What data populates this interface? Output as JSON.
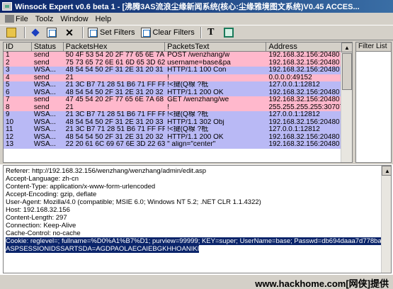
{
  "window": {
    "title": "Winsock Expert v0.6 beta 1 - [沸腾3AS流浪尘缘新闻系统(核心:尘缘雅境图文系统)V0.45 ACCES..."
  },
  "menu": {
    "items": [
      "File",
      "Toolz",
      "Window",
      "Help"
    ]
  },
  "toolbar": {
    "set_filters": "Set Filters",
    "clear_filters": "Clear Filters"
  },
  "grid": {
    "columns": [
      "ID",
      "Status",
      "PacketsHex",
      "PacketsText",
      "Address"
    ],
    "rows": [
      {
        "id": "1",
        "status": "send",
        "hex": "50 4F 53 54 20 2F 77 65 6E 7A 6...",
        "text": "POST /wenzhang/w",
        "address": "192.168.32.156:20480",
        "kind": "send"
      },
      {
        "id": "2",
        "status": "send",
        "hex": "75 73 65 72 6E 61 6D 65 3D 62 6...",
        "text": "username=base&pa",
        "address": "192.168.32.156:20480",
        "kind": "send"
      },
      {
        "id": "3",
        "status": "WSA...",
        "hex": "48 54 54 50 2F 31 2E 31 20 31 3...",
        "text": "HTTP/1.1 100 Con",
        "address": "192.168.32.156:20480",
        "kind": "recv"
      },
      {
        "id": "4",
        "status": "send",
        "hex": "21",
        "text": "!",
        "address": "0.0.0.0:49152",
        "kind": "send"
      },
      {
        "id": "5",
        "status": "WSA...",
        "hex": "21 3C B7 71 28 51 B6 71 FF FF F...",
        "text": "!<揵(Q楾          ?柢",
        "address": "127.0.0.1:12812",
        "kind": "recv"
      },
      {
        "id": "6",
        "status": "WSA...",
        "hex": "48 54 54 50 2F 31 2E 31 20 32 3...",
        "text": "HTTP/1.1 200 OK",
        "address": "192.168.32.156:20480",
        "kind": "recv"
      },
      {
        "id": "7",
        "status": "send",
        "hex": "47 45 54 20 2F 77 65 6E 7A 68 6...",
        "text": "GET /wenzhang/we",
        "address": "192.168.32.156:20480",
        "kind": "send"
      },
      {
        "id": "8",
        "status": "send",
        "hex": "21",
        "text": "!",
        "address": "255.255.255.255:30707",
        "kind": "send"
      },
      {
        "id": "9",
        "status": "WSA...",
        "hex": "21 3C B7 71 28 51 B6 71 FF FF F...",
        "text": "!<揵(Q楾          ?柢",
        "address": "127.0.0.1:12812",
        "kind": "recv"
      },
      {
        "id": "10",
        "status": "WSA...",
        "hex": "48 54 54 50 2F 31 2E 31 20 33 3...",
        "text": "HTTP/1.1 302 Obj",
        "address": "192.168.32.156:20480",
        "kind": "recv"
      },
      {
        "id": "11",
        "status": "WSA...",
        "hex": "21 3C B7 71 28 51 B6 71 FF FF F...",
        "text": "!<揵(Q楾          ?柢",
        "address": "127.0.0.1:12812",
        "kind": "recv"
      },
      {
        "id": "12",
        "status": "WSA...",
        "hex": "48 54 54 50 2F 31 2E 31 20 32 3...",
        "text": "HTTP/1.1 200 OK",
        "address": "192.168.32.156:20480",
        "kind": "recv"
      },
      {
        "id": "13",
        "status": "WSA...",
        "hex": "22 20 61 6C 69 67 6E 3D 22 63 6...",
        "text": "\" align=\"center\"",
        "address": "192.168.32.156:20480",
        "kind": "recv"
      }
    ]
  },
  "filter_panel": {
    "label": "Filter List"
  },
  "detail": {
    "lines": [
      "Referer: http://192.168.32.156/wenzhang/wenzhang/admin/edit.asp",
      "Accept-Language: zh-cn",
      "Content-Type: application/x-www-form-urlencoded",
      "Accept-Encoding: gzip, deflate",
      "User-Agent: Mozilla/4.0 (compatible; MSIE 6.0; Windows NT 5.2; .NET CLR 1.1.4322)",
      "Host: 192.168.32.156",
      "Content-Length: 297",
      "Connection: Keep-Alive",
      "Cache-Control: no-cache"
    ],
    "highlighted": [
      "Cookie: reglevel=; fullname=%D0%A1%B7%D1; purview=99999; KEY=super; UserName=base; Passwd=db694daaa7d778ba;",
      "ASPSESSIONIDSSARTSDA=AGDPAOLAECAIEBGKHHOANIKI"
    ]
  },
  "watermark": "www.hackhome.com[网侠]提供",
  "colors": {
    "send_row": "#ffb8cc",
    "recv_row": "#b9b9f5",
    "selection": "#0a246a"
  }
}
